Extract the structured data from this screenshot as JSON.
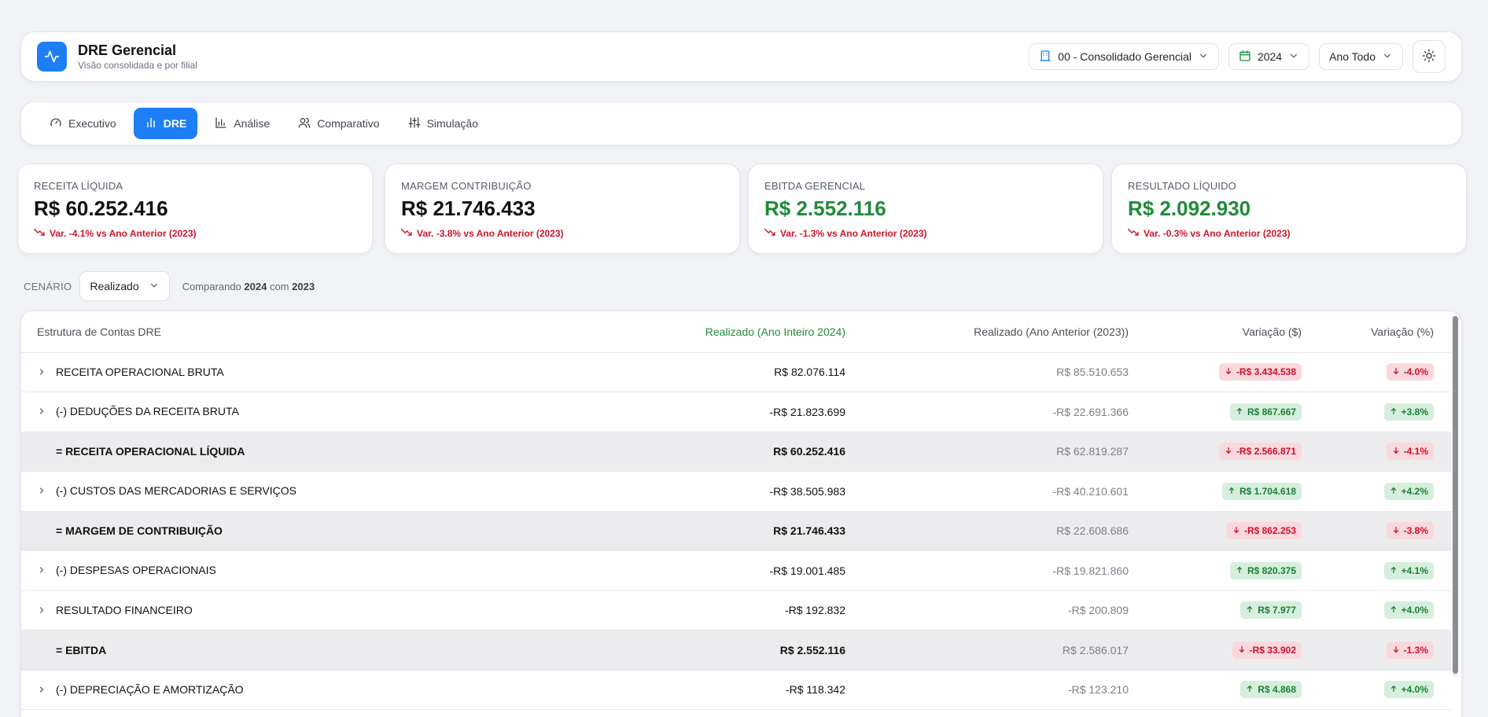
{
  "header": {
    "title": "DRE Gerencial",
    "subtitle": "Visão consolidada e por filial",
    "filial_select": "00 - Consolidado Gerencial",
    "year_select": "2024",
    "period_select": "Ano Todo",
    "theme_icon": "sun-icon"
  },
  "tabs": [
    {
      "label": "Executivo",
      "icon": "gauge-icon"
    },
    {
      "label": "DRE",
      "icon": "bar-chart-icon",
      "active": true
    },
    {
      "label": "Análise",
      "icon": "column-chart-icon"
    },
    {
      "label": "Comparativo",
      "icon": "users-icon"
    },
    {
      "label": "Simulação",
      "icon": "sliders-icon"
    }
  ],
  "kpis": [
    {
      "label": "RECEITA LÍQUIDA",
      "value": "R$ 60.252.416",
      "variation": "Var. -4.1% vs Ano Anterior (2023)"
    },
    {
      "label": "MARGEM CONTRIBUIÇÃO",
      "value": "R$ 21.746.433",
      "variation": "Var. -3.8% vs Ano Anterior (2023)"
    },
    {
      "label": "EBITDA GERENCIAL",
      "value": "R$ 2.552.116",
      "variation": "Var. -1.3% vs Ano Anterior (2023)"
    },
    {
      "label": "RESULTADO LÍQUIDO",
      "value": "R$ 2.092.930",
      "variation": "Var. -0.3% vs Ano Anterior (2023)"
    }
  ],
  "scenario": {
    "label": "CENÁRIO",
    "value": "Realizado",
    "compare_prefix": "Comparando",
    "compare_year_a": "2024",
    "compare_mid": "com",
    "compare_year_b": "2023"
  },
  "table": {
    "headers": [
      "Estrutura de Contas DRE",
      "Realizado (Ano Inteiro 2024)",
      "Realizado (Ano Anterior (2023))",
      "Variação ($)",
      "Variação (%)"
    ],
    "rows": [
      {
        "account": "RECEITA OPERACIONAL BRUTA",
        "current": "R$ 82.076.114",
        "previous": "R$ 85.510.653",
        "var_abs": "-R$ 3.434.538",
        "var_pct": "-4.0%",
        "expandable": true
      },
      {
        "account": "(-) DEDUÇÕES DA RECEITA BRUTA",
        "current": "-R$ 21.823.699",
        "previous": "-R$ 22.691.366",
        "var_abs": "R$ 867.667",
        "var_pct": "+3.8%",
        "expandable": true
      },
      {
        "account": "= RECEITA OPERACIONAL LÍQUIDA",
        "current": "R$ 60.252.416",
        "previous": "R$ 62.819.287",
        "var_abs": "-R$ 2.566.871",
        "var_pct": "-4.1%",
        "expandable": false
      },
      {
        "account": "(-) CUSTOS DAS MERCADORIAS E SERVIÇOS",
        "current": "-R$ 38.505.983",
        "previous": "-R$ 40.210.601",
        "var_abs": "R$ 1.704.618",
        "var_pct": "+4.2%",
        "expandable": true
      },
      {
        "account": "= MARGEM DE CONTRIBUIÇÃO",
        "current": "R$ 21.746.433",
        "previous": "R$ 22.608.686",
        "var_abs": "-R$ 862.253",
        "var_pct": "-3.8%",
        "expandable": false
      },
      {
        "account": "(-) DESPESAS OPERACIONAIS",
        "current": "-R$ 19.001.485",
        "previous": "-R$ 19.821.860",
        "var_abs": "R$ 820.375",
        "var_pct": "+4.1%",
        "expandable": true
      },
      {
        "account": "RESULTADO FINANCEIRO",
        "current": "-R$ 192.832",
        "previous": "-R$ 200.809",
        "var_abs": "R$ 7.977",
        "var_pct": "+4.0%",
        "expandable": true
      },
      {
        "account": "= EBITDA",
        "current": "R$ 2.552.116",
        "previous": "R$ 2.586.017",
        "var_abs": "-R$ 33.902",
        "var_pct": "-1.3%",
        "expandable": false
      },
      {
        "account": "(-) DEPRECIAÇÃO E AMORTIZAÇÃO",
        "current": "-R$ 118.342",
        "previous": "-R$ 123.210",
        "var_abs": "R$ 4.868",
        "var_pct": "+4.0%",
        "expandable": true
      }
    ]
  },
  "colors": {
    "accent": "#1e7ef5",
    "positive": "#1f8b3a",
    "negative": "#d0142c"
  }
}
